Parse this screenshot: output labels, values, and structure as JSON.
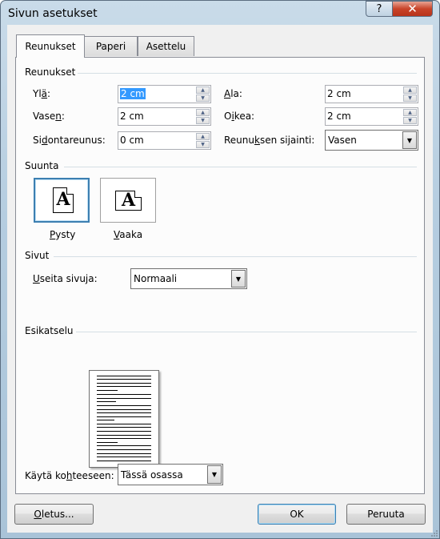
{
  "window": {
    "title": "Sivun asetukset",
    "help_label": "?",
    "close_label": "✕"
  },
  "tabs": [
    {
      "label": "Reunukset",
      "active": true
    },
    {
      "label": "Paperi",
      "active": false
    },
    {
      "label": "Asettelu",
      "active": false
    }
  ],
  "margins": {
    "section_title": "Reunukset",
    "top": {
      "label_pre": "Yl",
      "label_u": "ä",
      "label_post": ":",
      "value": "2 cm"
    },
    "bottom": {
      "label_pre": "",
      "label_u": "A",
      "label_post": "la:",
      "value": "2 cm"
    },
    "left": {
      "label_pre": "Vase",
      "label_u": "n",
      "label_post": ":",
      "value": "2 cm"
    },
    "right": {
      "label_pre": "O",
      "label_u": "i",
      "label_post": "kea:",
      "value": "2 cm"
    },
    "gutter": {
      "label_pre": "Si",
      "label_u": "d",
      "label_post": "ontareunus:",
      "value": "0 cm"
    },
    "gutter_position": {
      "label_pre": "Reunu",
      "label_u": "k",
      "label_post": "sen sijainti:",
      "value": "Vasen"
    }
  },
  "orientation": {
    "section_title": "Suunta",
    "portrait": {
      "label": "Pysty",
      "u": "P",
      "rest": "ysty",
      "glyph": "A",
      "selected": true
    },
    "landscape": {
      "label": "Vaaka",
      "u": "V",
      "rest": "aaka",
      "glyph": "A",
      "selected": false
    }
  },
  "pages": {
    "section_title": "Sivut",
    "multiple_label_pre": "",
    "multiple_label_u": "U",
    "multiple_label_post": "seita sivuja:",
    "multiple_value": "Normaali"
  },
  "preview": {
    "section_title": "Esikatselu",
    "apply_label_pre": "Käytä ko",
    "apply_label_u": "h",
    "apply_label_post": "teeseen:",
    "apply_value": "Tässä osassa"
  },
  "buttons": {
    "default_pre": "",
    "default_u": "O",
    "default_post": "letus...",
    "ok": "OK",
    "cancel": "Peruuta"
  },
  "colors": {
    "selection": "#3399ff",
    "close_button": "#c8442a",
    "focus_border": "#3c7fb1"
  }
}
